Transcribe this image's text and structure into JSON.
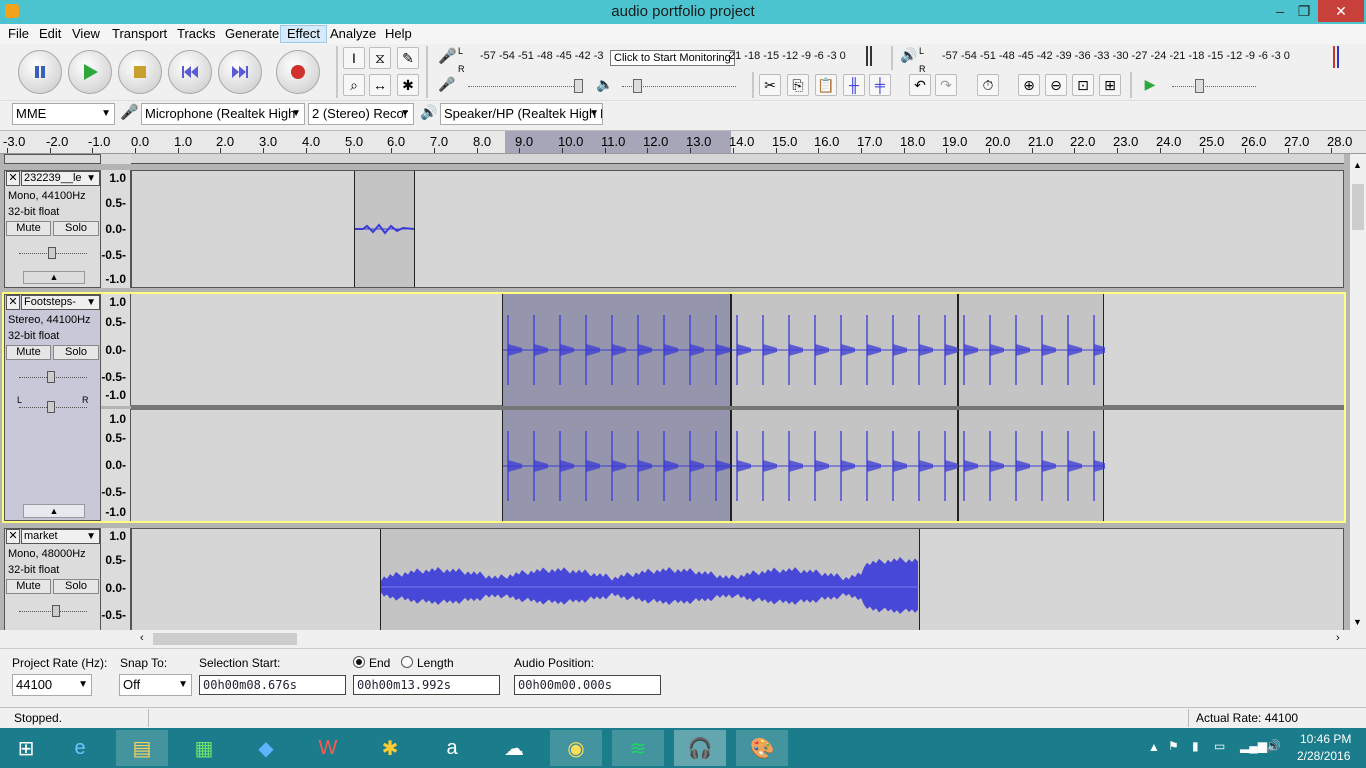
{
  "window": {
    "title": "audio portfolio project",
    "minimize": "–",
    "restore": "❐",
    "close": "✕"
  },
  "menu": {
    "items": [
      "File",
      "Edit",
      "View",
      "Transport",
      "Tracks",
      "Generate",
      "Effect",
      "Analyze",
      "Help"
    ],
    "active": "Effect"
  },
  "transport": {
    "pause_icon": "pause-icon",
    "play_icon": "play-icon",
    "stop_icon": "stop-icon",
    "skip_start_icon": "skip-to-start-icon",
    "skip_end_icon": "skip-to-end-icon",
    "record_icon": "record-icon"
  },
  "meters": {
    "record_scale": "-57 -54 -51 -48 -45 -42 -3",
    "record_scale_tail": "21 -18 -15 -12 -9 -6 -3 0",
    "tooltip": "Click to Start Monitoring",
    "playback_scale": "-57 -54 -51 -48 -45 -42 -39 -36 -33 -30 -27 -24 -21 -18 -15 -12 -9 -6 -3 0",
    "L": "L",
    "R": "R"
  },
  "device_toolbar": {
    "host": "MME",
    "recording_device": "Microphone (Realtek High",
    "channels": "2 (Stereo) Recor",
    "playback_device": "Speaker/HP (Realtek High I"
  },
  "timeline": {
    "ticks": [
      "-3.0",
      "-2.0",
      "-1.0",
      "0.0",
      "1.0",
      "2.0",
      "3.0",
      "4.0",
      "5.0",
      "6.0",
      "7.0",
      "8.0",
      "9.0",
      "10.0",
      "11.0",
      "12.0",
      "13.0",
      "14.0",
      "15.0",
      "16.0",
      "17.0",
      "18.0",
      "19.0",
      "20.0",
      "21.0",
      "22.0",
      "23.0",
      "24.0",
      "25.0",
      "26.0",
      "27.0",
      "28.0"
    ]
  },
  "tracks": [
    {
      "name": "232239__le",
      "format": "Mono, 44100Hz",
      "bitdepth": "32-bit float",
      "mute": "Mute",
      "solo": "Solo",
      "labels": [
        "1.0",
        "0.5-",
        "0.0-",
        "-0.5-",
        "-1.0"
      ]
    },
    {
      "name": "Footsteps-",
      "format": "Stereo, 44100Hz",
      "bitdepth": "32-bit float",
      "mute": "Mute",
      "solo": "Solo",
      "labels": [
        "1.0",
        "0.5-",
        "0.0-",
        "-0.5-",
        "-1.0"
      ],
      "labels2": [
        "1.0",
        "0.5-",
        "0.0-",
        "-0.5-",
        "-1.0"
      ],
      "gain_l": "L",
      "gain_r": "R"
    },
    {
      "name": "market",
      "format": "Mono, 48000Hz",
      "bitdepth": "32-bit float",
      "mute": "Mute",
      "solo": "Solo",
      "labels": [
        "1.0",
        "0.5-",
        "0.0-",
        "-0.5-"
      ]
    }
  ],
  "selection_toolbar": {
    "project_rate_label": "Project Rate (Hz):",
    "project_rate": "44100",
    "snap_to_label": "Snap To:",
    "snap_to": "Off",
    "selection_start_label": "Selection Start:",
    "end_label": "End",
    "length_label": "Length",
    "audio_position_label": "Audio Position:",
    "selection_start": "00h00m08.676s",
    "selection_end": "00h00m13.992s",
    "audio_position": "00h00m00.000s"
  },
  "status": {
    "text": "Stopped.",
    "actual_rate": "Actual Rate: 44100"
  },
  "taskbar": {
    "time": "10:46 PM",
    "date": "2/28/2016",
    "apps": [
      "windows-start-icon",
      "internet-explorer-icon",
      "file-explorer-icon",
      "store-icon",
      "dropbox-icon",
      "wps-icon",
      "paint-icon",
      "amazon-icon",
      "onedrive-icon",
      "chrome-icon",
      "spotify-icon",
      "audacity-icon",
      "paint-palette-icon"
    ]
  }
}
